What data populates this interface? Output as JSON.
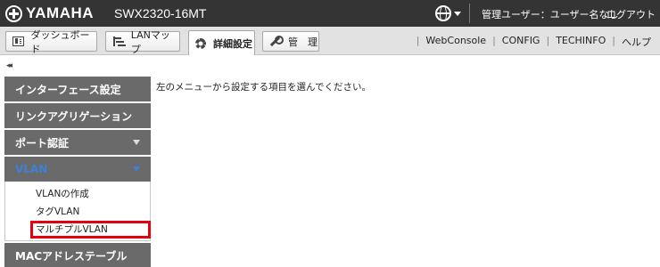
{
  "header": {
    "brand": "YAMAHA",
    "model": "SWX2320-16MT",
    "user_info": "管理ユーザー：ユーザー名なし",
    "logout": "ログアウト"
  },
  "tabs": [
    {
      "label": "ダッシュボード",
      "icon": "dashboard-icon"
    },
    {
      "label": "LANマップ",
      "icon": "lan-map-icon"
    },
    {
      "label": "詳細設定",
      "icon": "gear-icon",
      "active": true
    },
    {
      "label": "管　理",
      "icon": "wrench-icon"
    }
  ],
  "top_links": [
    "WebConsole",
    "CONFIG",
    "TECHINFO",
    "ヘルプ"
  ],
  "sidebar": {
    "collapse": "◂◂",
    "items": [
      {
        "label": "インターフェース設定"
      },
      {
        "label": "リンクアグリゲーション"
      },
      {
        "label": "ポート認証"
      },
      {
        "label": "VLAN",
        "sub": [
          "VLANの作成",
          "タグVLAN",
          "マルチプルVLAN"
        ]
      },
      {
        "label": "MACアドレステーブル"
      }
    ]
  },
  "main": {
    "message": "左のメニューから設定する項目を選んでください。"
  },
  "colors": {
    "topbar": "#343434",
    "nav": "#6a6a6a",
    "vlan_label": "#3c80d8",
    "highlight": "#e4000f"
  }
}
